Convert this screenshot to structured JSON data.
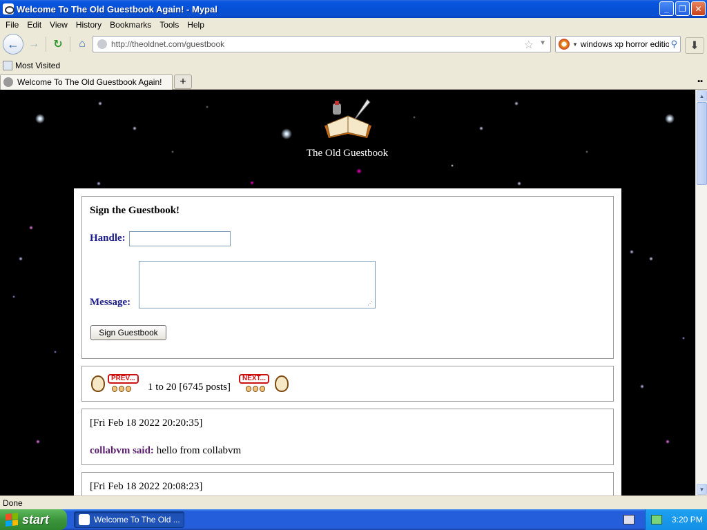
{
  "window": {
    "title": "Welcome To The Old Guestbook Again! - Mypal",
    "min_label": "_",
    "max_label": "❐",
    "close_label": "✕"
  },
  "menu": [
    "File",
    "Edit",
    "View",
    "History",
    "Bookmarks",
    "Tools",
    "Help"
  ],
  "nav": {
    "url_host": "http://theoldnet.com",
    "url_path": "/guestbook",
    "search_value": "windows xp horror edition"
  },
  "bookmarks": {
    "most_visited": "Most Visited"
  },
  "tabs": {
    "active_label": "Welcome To The Old Guestbook Again!",
    "new_tab": "+"
  },
  "page": {
    "logo_caption": "The Old Guestbook",
    "form": {
      "title": "Sign the Guestbook!",
      "handle_label": "Handle:",
      "message_label": "Message:",
      "handle_value": "",
      "message_value": "",
      "submit_label": "Sign Guestbook"
    },
    "pager": {
      "prev_label": "PREV...",
      "next_label": "NEXT...",
      "range_text": "1 to 20 [6745 posts]"
    },
    "posts": [
      {
        "date": "[Fri Feb 18 2022 20:20:35]",
        "author": "collabvm said:",
        "message": "hello from collabvm"
      },
      {
        "date": "[Fri Feb 18 2022 20:08:23]"
      }
    ]
  },
  "status": {
    "text": "Done"
  },
  "taskbar": {
    "start_label": "start",
    "window_label": "Welcome To The Old ...",
    "clock": "3:20 PM"
  },
  "colors": {
    "label_blue": "#1b1b8a",
    "author_purple": "#5a1e6e",
    "taskbar_blue": "#245edb",
    "start_green": "#3c963c"
  }
}
